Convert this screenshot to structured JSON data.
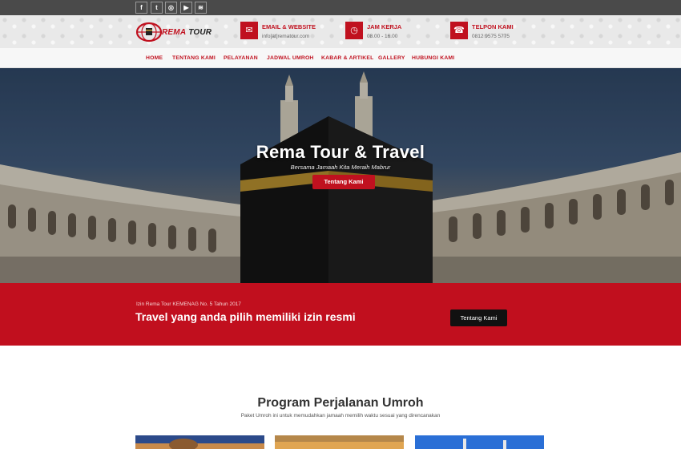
{
  "social": [
    {
      "icon": "facebook-icon",
      "glyph": "f"
    },
    {
      "icon": "twitter-icon",
      "glyph": "t"
    },
    {
      "icon": "instagram-icon",
      "glyph": "◎"
    },
    {
      "icon": "youtube-icon",
      "glyph": "▶"
    },
    {
      "icon": "rss-icon",
      "glyph": "≋"
    }
  ],
  "logo": {
    "brand_red": "REMA",
    "brand_dark": " TOUR"
  },
  "contact": [
    {
      "icon": "envelope-icon",
      "glyph": "✉",
      "title": "EMAIL & WEBSITE",
      "value": "info[at]rematour.com"
    },
    {
      "icon": "clock-icon",
      "glyph": "◷",
      "title": "JAM KERJA",
      "value": "08.00 - 16.00"
    },
    {
      "icon": "phone-icon",
      "glyph": "☎",
      "title": "TELPON KAMI",
      "value": "0812 9575 5775"
    }
  ],
  "nav": [
    "HOME",
    "TENTANG KAMI",
    "PELAYANAN",
    "JADWAL UMROH",
    "KABAR & ARTIKEL",
    "GALLERY",
    "HUBUNGI KAMI"
  ],
  "hero": {
    "title": "Rema Tour & Travel",
    "subtitle": "Bersama Jamaah Kita Meraih Mabrur",
    "button": "Tentang Kami"
  },
  "license": {
    "small": "Izin Rema Tour KEMENAG No. 5 Tahun 2017",
    "headline": "Travel yang anda pilih memiliki izin resmi",
    "button": "Tentang Kami"
  },
  "program": {
    "title": "Program Perjalanan Umroh",
    "subtitle": "Paket Umroh ini untuk memudahkan jamaah memilih waktu sesuai yang direncanakan"
  },
  "colors": {
    "brand": "#c0111f",
    "dark_bar": "#4a4a4a",
    "button_dark": "#111111"
  }
}
